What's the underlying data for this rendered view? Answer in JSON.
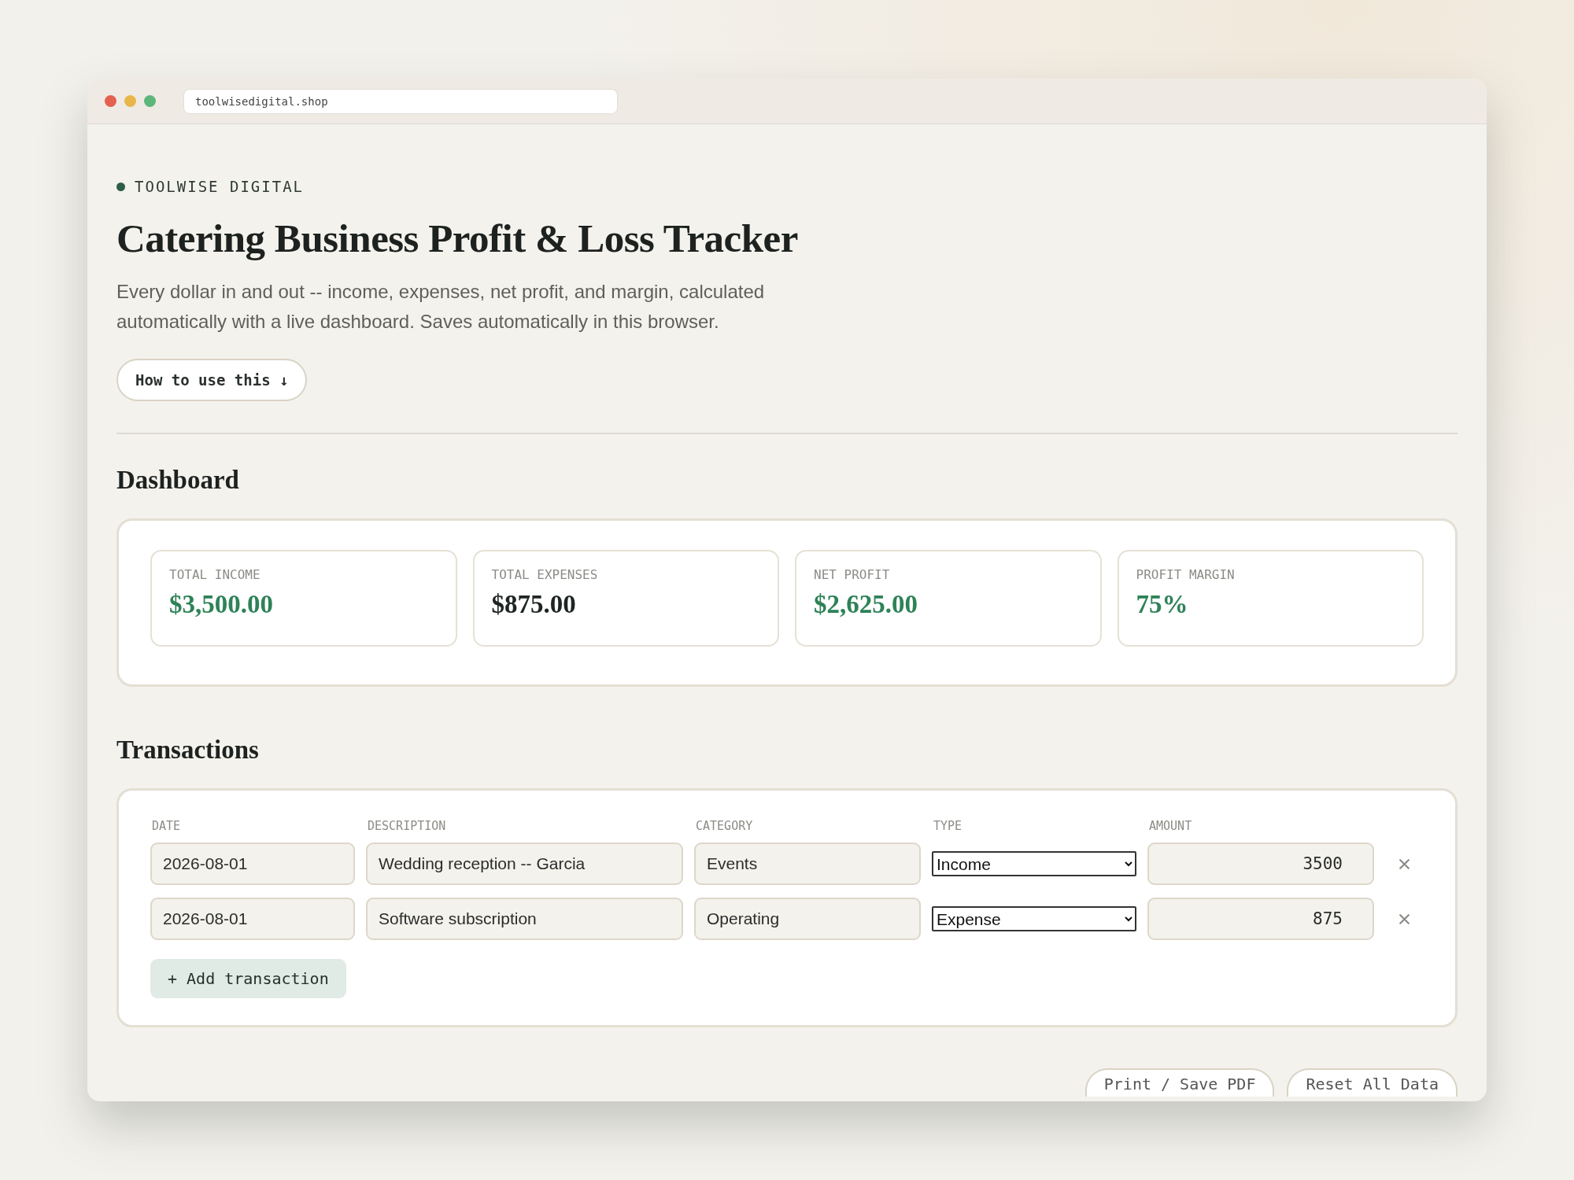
{
  "browser": {
    "url": "toolwisedigital.shop"
  },
  "brand": "TOOLWISE DIGITAL",
  "title": "Catering Business Profit & Loss Tracker",
  "description": "Every dollar in and out -- income, expenses, net profit, and margin, calculated automatically with a live dashboard. Saves automatically in this browser.",
  "how_to_button": "How to use this ↓",
  "dashboard": {
    "heading": "Dashboard",
    "cards": [
      {
        "label": "TOTAL INCOME",
        "value": "$3,500.00",
        "positive": true
      },
      {
        "label": "TOTAL EXPENSES",
        "value": "$875.00",
        "positive": false
      },
      {
        "label": "NET PROFIT",
        "value": "$2,625.00",
        "positive": true
      },
      {
        "label": "PROFIT MARGIN",
        "value": "75%",
        "positive": true
      }
    ]
  },
  "transactions": {
    "heading": "Transactions",
    "columns": [
      "DATE",
      "DESCRIPTION",
      "CATEGORY",
      "TYPE",
      "AMOUNT"
    ],
    "rows": [
      {
        "date": "2026-08-01",
        "description": "Wedding reception -- Garcia",
        "category": "Events",
        "type": "Income",
        "amount": "3500"
      },
      {
        "date": "2026-08-01",
        "description": "Software subscription",
        "category": "Operating",
        "type": "Expense",
        "amount": "875"
      }
    ],
    "add_button": "+ Add transaction"
  },
  "footer_buttons": [
    "Print / Save PDF",
    "Reset All Data"
  ]
}
